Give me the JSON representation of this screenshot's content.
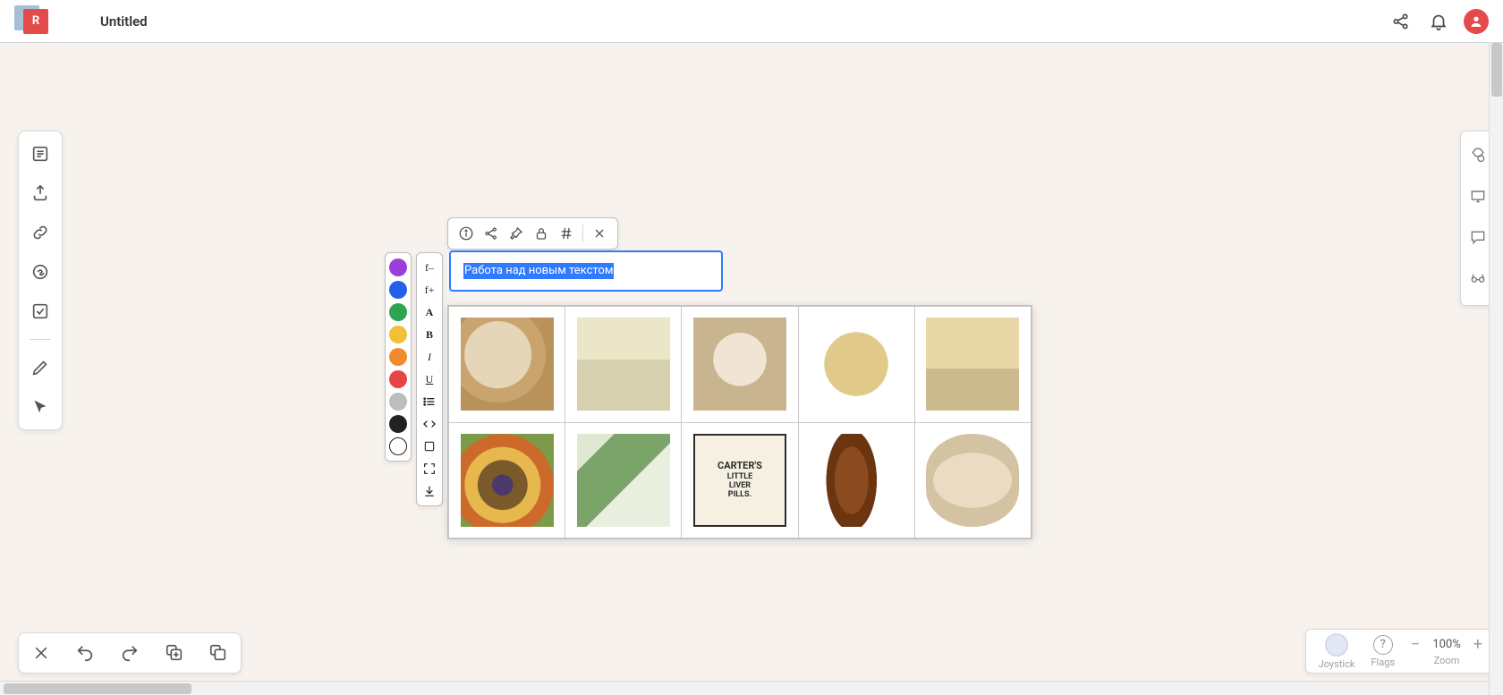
{
  "header": {
    "app_badge": "R",
    "title": "Untitled"
  },
  "text_node": {
    "value": "Работа над новым текстом"
  },
  "context_bar": {
    "items": [
      "info",
      "share",
      "pin",
      "lock",
      "hash",
      "close"
    ]
  },
  "color_swatches": [
    "#9b3fd9",
    "#2760e8",
    "#2ea44f",
    "#f2c037",
    "#f08a2c",
    "#e64545",
    "#bdbdbd",
    "#222222"
  ],
  "format_col": {
    "font_dec": "f–",
    "font_inc": "f+",
    "font_family": "A",
    "bold": "B",
    "italic": "I",
    "underline": "U"
  },
  "grid": {
    "thumb_labels": {
      "t7_line1": "CARTER'S",
      "t7_line2": "LITTLE",
      "t7_line3": "LIVER",
      "t7_line4": "PILLS."
    }
  },
  "bottom_right": {
    "joystick": "Joystick",
    "flags": "Flags",
    "zoom_label": "Zoom",
    "zoom_value": "100%"
  }
}
